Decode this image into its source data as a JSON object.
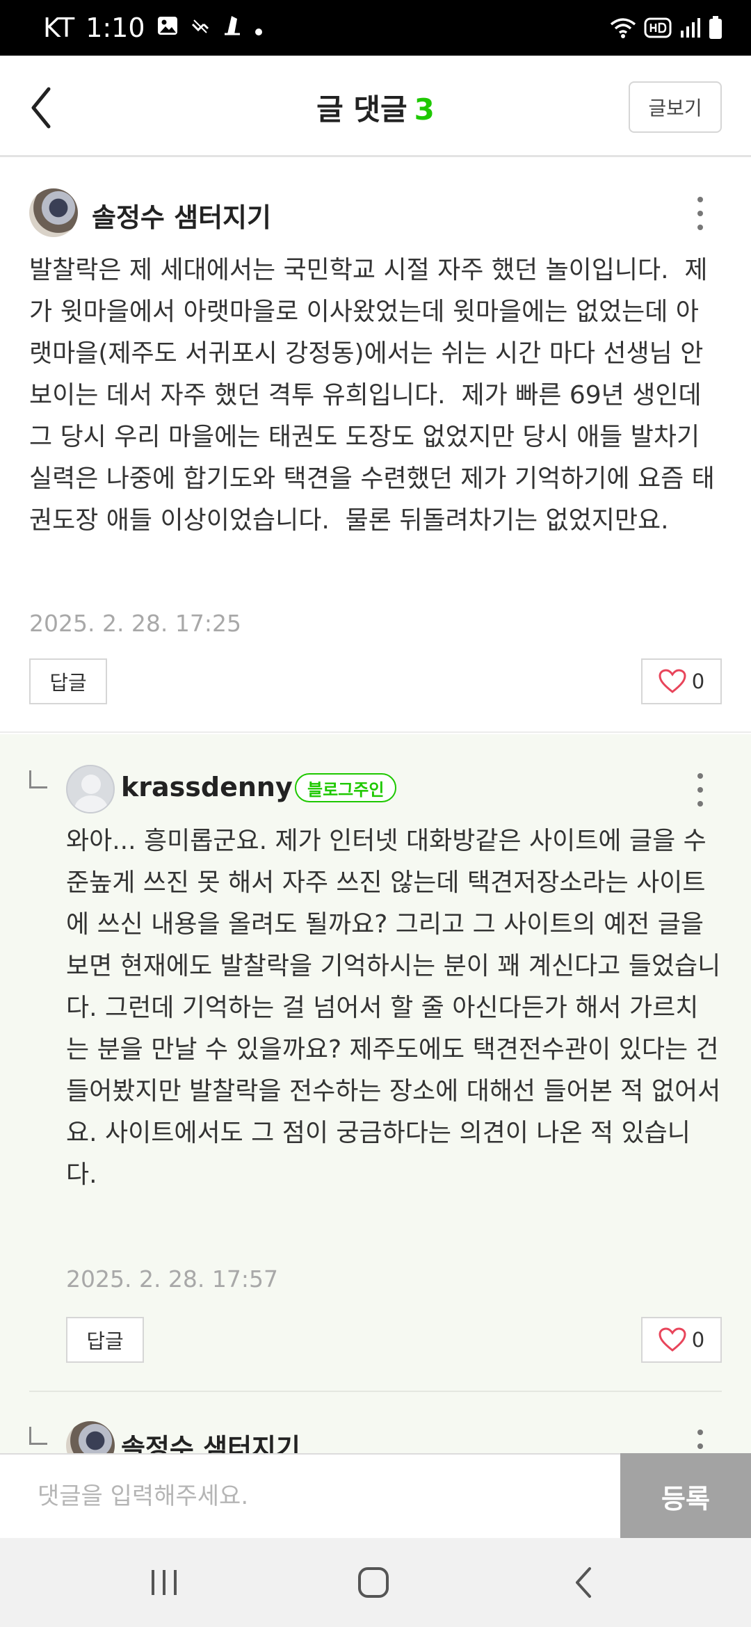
{
  "status_bar": {
    "carrier": "KT",
    "time": "1:10",
    "icons": [
      "image-icon",
      "missed-call-icon",
      "app-notification-icon",
      "dot-icon",
      "wifi-icon",
      "hd-icon",
      "signal-icon",
      "battery-icon"
    ]
  },
  "header": {
    "title": "글 댓글",
    "count": "3",
    "view_post_label": "글보기",
    "accent_color": "#1ec800"
  },
  "comments": [
    {
      "author": "솔정수 샘터지기",
      "text": "발찰락은 제 세대에서는 국민학교 시절 자주 했던 놀이입니다.  제가 윗마을에서 아랫마을로 이사왔었는데 윗마을에는 없었는데 아랫마을(제주도 서귀포시 강정동)에서는 쉬는 시간 마다 선생님 안보이는 데서 자주 했던 격투 유희입니다.  제가 빠른 69년 생인데 그 당시 우리 마을에는 태권도 도장도 없었지만 당시 애들 발차기 실력은 나중에 합기도와 택견을 수련했던 제가 기억하기에 요즘 태권도장 애들 이상이었습니다.  물론 뒤돌려차기는 없었지만요.",
      "date": "2025. 2. 28. 17:25",
      "reply_label": "답글",
      "likes": "0"
    },
    {
      "author": "krassdenny",
      "badge": "블로그주인",
      "text": "와아... 흥미롭군요. 제가 인터넷 대화방같은 사이트에 글을 수준높게 쓰진 못 해서 자주 쓰진 않는데 택견저장소라는 사이트에 쓰신 내용을 올려도 될까요? 그리고 그 사이트의 예전 글을 보면 현재에도 발찰락을 기억하시는 분이 꽤 계신다고 들었습니다. 그런데 기억하는 걸 넘어서 할 줄 아신다든가 해서 가르치는 분을 만날 수 있을까요? 제주도에도 택견전수관이 있다는 건 들어봤지만 발찰락을 전수하는 장소에 대해선 들어본 적 없어서요. 사이트에서도 그 점이 궁금하다는 의견이 나온 적 있습니다.",
      "date": "2025. 2. 28. 17:57",
      "reply_label": "답글",
      "likes": "0"
    },
    {
      "author": "솔정수 샘터지기"
    }
  ],
  "input_bar": {
    "placeholder": "댓글을 입력해주세요.",
    "submit_label": "등록"
  },
  "nav_bar": {
    "icons": [
      "recent-apps-icon",
      "home-icon",
      "back-nav-icon"
    ]
  }
}
